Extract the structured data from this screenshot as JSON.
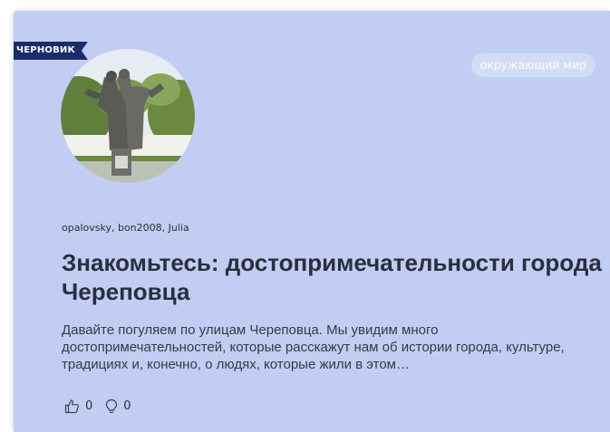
{
  "card": {
    "draft_label": "ЧЕРНОВИК",
    "topic_tag": "окружающий мир",
    "authors": "opalovsky, bon2008, Julia",
    "title": "Знакомьтесь: достопримечательности города Череповца",
    "excerpt": "Давайте погуляем по улицам Череповца. Мы увидим много достопримечательностей, которые расскажут нам об истории города, культуре, традициях и, конечно, о людях, которые жили в этом…",
    "likes": "0",
    "ideas": "0",
    "thumbnail_icon": "monument-photo"
  },
  "colors": {
    "card_background": "#c1cdf3",
    "ribbon": "#1a2d6b",
    "text": "#2a2f3b"
  }
}
